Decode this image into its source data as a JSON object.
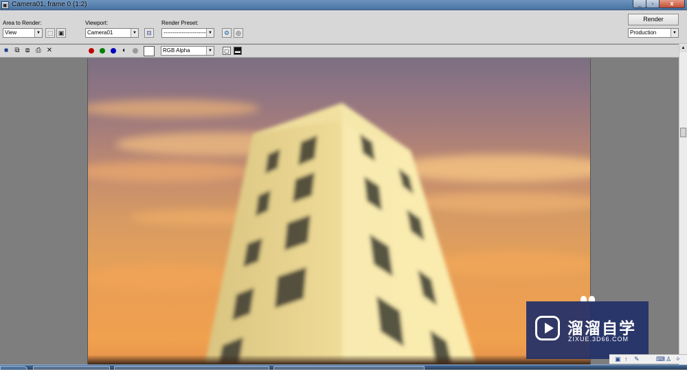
{
  "window": {
    "title": "Camera01, frame 0 (1:2)"
  },
  "toolbar": {
    "area_label": "Area to Render:",
    "area_value": "View",
    "viewport_label": "Viewport:",
    "viewport_value": "Camera01",
    "preset_label": "Render Preset:",
    "preset_value": "-----------------------------",
    "render_label": "Render",
    "production_value": "Production"
  },
  "toolbar2": {
    "channel_value": "RGB Alpha"
  },
  "colors": {
    "red_channel": "#c00000",
    "green_channel": "#008000",
    "blue_channel": "#0000c0",
    "watermark_bg": "#223068"
  },
  "icons": {
    "save": "save-image-icon",
    "copy": "copy-image-icon",
    "clone": "clone-window-icon",
    "print": "print-image-icon",
    "clear": "clear-icon",
    "lock": "lock-icon"
  },
  "watermark": {
    "brand": "溜溜自学",
    "url": "ZIXUE.3D66.COM"
  }
}
